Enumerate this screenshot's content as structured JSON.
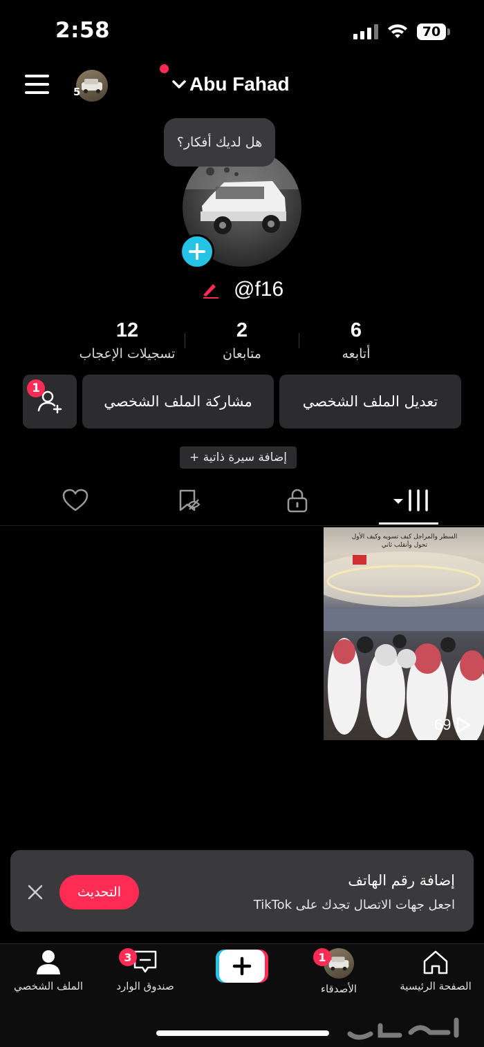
{
  "status_bar": {
    "time": "2:58",
    "battery": "70"
  },
  "header": {
    "account_count": "5",
    "username": "Abu Fahad"
  },
  "profile": {
    "bubble_text": "هل لديك أفكار؟",
    "handle": "@f16"
  },
  "stats": {
    "likes": {
      "value": "12",
      "label": "تسجيلات الإعجاب"
    },
    "followers": {
      "value": "2",
      "label": "متابعان"
    },
    "following": {
      "value": "6",
      "label": "أتابعه"
    }
  },
  "actions": {
    "edit_profile": "تعديل الملف الشخصي",
    "share_profile": "مشاركة الملف الشخصي",
    "add_friends_badge": "1",
    "add_bio": "+ إضافة سيرة ذاتية"
  },
  "tabs": [
    "videos-tab",
    "private-tab",
    "reposts-tab",
    "liked-tab"
  ],
  "videos": [
    {
      "views": "69",
      "caption": "السطر والمراجل كيف تسويه وكيف الأول تحول وأنقلب ثاني"
    }
  ],
  "toast": {
    "title": "إضافة رقم الهاتف",
    "subtitle": "اجعل جهات الاتصال تجدك على TikTok",
    "update_button": "التحديث"
  },
  "bottom_nav": {
    "home": "الصفحة الرئيسية",
    "friends": "الأصدقاء",
    "friends_badge": "1",
    "inbox": "صندوق الوارد",
    "inbox_badge": "3",
    "profile": "الملف الشخصي"
  },
  "colors": {
    "accent": "#fe2c55",
    "cyan": "#25c3e6",
    "surface": "#2c2c2e"
  }
}
